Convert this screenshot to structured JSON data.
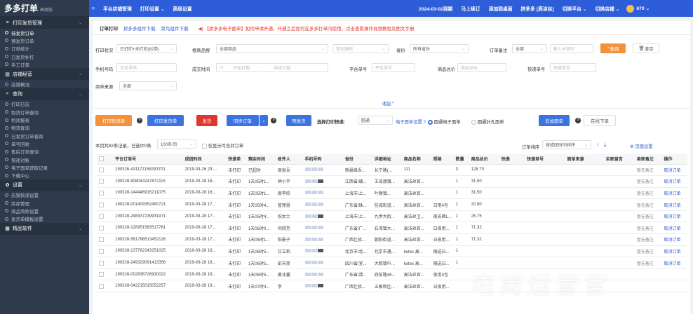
{
  "app": {
    "logo": "多多打单",
    "edition": "高级版"
  },
  "sidebar": {
    "sections": [
      {
        "label": "打印发货管理",
        "icon": "menu-icon",
        "items": [
          "待发货订单",
          "预发货订单",
          "订单统计",
          "已发货补打",
          "手工订单"
        ]
      },
      {
        "label": "店铺经营",
        "icon": "chart-icon",
        "items": [
          "店铺概况"
        ]
      },
      {
        "label": "查询",
        "icon": "search-icon",
        "items": [
          "打印日志",
          "取消订单查询",
          "利润报表",
          "物流查询",
          "已发货订单查询",
          "单号回收",
          "售后订单查询",
          "快递对账",
          "电子面单获取记录",
          "下载中心"
        ]
      },
      {
        "label": "设置",
        "icon": "gear-icon",
        "items": [
          "店铺快递设置",
          "库存管理",
          "商品简称设置",
          "发货单模板设置"
        ]
      },
      {
        "label": "精品软件",
        "icon": "grid-icon",
        "items": []
      }
    ]
  },
  "topbar": {
    "menu": [
      "平台店铺管理",
      "打印设置",
      "高级设置"
    ],
    "date": "2024-03-02到期",
    "renew": "马上续订",
    "add_desktop": "添加到桌面",
    "shop": "拼多多 [高洁丝]",
    "switch_platform": "切换平台",
    "switch_shop": "切换店铺",
    "count": "670"
  },
  "tabs": {
    "items": [
      "订单打印",
      "拼多多组件下载",
      "菜鸟组件下载"
    ],
    "notice": "【拼多多电子面单】如何申请开通，开通之后如何在多多打单内使用，点击查看操作视频教程及图文手册"
  },
  "filters": {
    "print_status": {
      "label": "打印状况",
      "value": "已打印+未打印(82单)"
    },
    "goods": {
      "label": "搜商品搜",
      "value": "全部商品"
    },
    "flag": {
      "placeholder": "暂无旗帜"
    },
    "province": {
      "label": "省份",
      "value": "所有省份"
    },
    "remark": {
      "label": "订单备注",
      "value": "全部",
      "placeholder": "输入关键字"
    },
    "query_btn": "查询",
    "clear_btn": "清空",
    "phone": {
      "label": "手机号码",
      "placeholder": "手机号码"
    },
    "deal_time": {
      "label": "成交时间",
      "start": "开始日期",
      "sep": "-",
      "end": "结束日期"
    },
    "platform_no": {
      "label": "平台单号",
      "placeholder": "平台单号"
    },
    "total": {
      "label": "商品总价",
      "placeholder": "商品总价"
    },
    "express_no": {
      "label": "快递单号",
      "placeholder": "快递单号"
    },
    "source": {
      "label": "商单来源",
      "value": "全部"
    },
    "collapse": "收起"
  },
  "actions": {
    "print_express": "打印快递单",
    "print_ship": "打印发货单",
    "ship": "发货",
    "sync": "同步订单",
    "pre_ship": "预发货",
    "choose_express": "选择打印快递:",
    "express_value": "圆通",
    "express_set": "电子面单设置",
    "radio1": "圆通电子面单",
    "radio2": "圆通针孔面单",
    "append": "追加面单",
    "online": "在线下单"
  },
  "summary": {
    "text": "本页共82条记录，已选中0条",
    "per_page": "100条/页",
    "merge": "仅显示可合并订单",
    "sort_label": "订单排序",
    "sort_value": "按成团时间排序",
    "page_settings": "页面设置"
  },
  "columns": [
    "平台订单号",
    "成团时间",
    "快递单",
    "剩余时间",
    "收件人",
    "手机号码",
    "省份",
    "详细地址",
    "商品名称",
    "规格",
    "数量",
    "商品总价",
    "快递",
    "快递单号",
    "面单来源",
    "买家留言",
    "卖家备注",
    "操作"
  ],
  "rows": [
    {
      "order": "190326-431172158293701",
      "time": "2019-03-26 23:...",
      "express": "未打印",
      "remain": "已超时",
      "name": "周俊吾",
      "province": "新疆维吾...",
      "addr": "长宁路(...",
      "goods": "111",
      "spec": "",
      "qty": "3",
      "price": "128.70",
      "remark": "暂无备注",
      "op": "取消订单"
    },
    {
      "order": "190328-508044247872115",
      "time": "2019-03-28 16...",
      "express": "未打印",
      "remain": "1天05时1...",
      "name": "钟小平",
      "province": "江西省/赣...",
      "addr": "王母渡镇...",
      "goods": "高洁丝官...",
      "spec": "",
      "qty": "1",
      "price": "31.50",
      "remark": "暂无备注",
      "op": "取消订单"
    },
    {
      "order": "190328-144446915211075",
      "time": "2019-03-28 16...",
      "express": "未打印",
      "remain": "1天05时1...",
      "name": "周李欣",
      "province": "上海市/上...",
      "addr": "叶榭镇...",
      "goods": "高洁丝官...",
      "spec": "",
      "qty": "1",
      "price": "31.50",
      "remark": "暂无备注",
      "op": "取消订单"
    },
    {
      "order": "190328-001409352490721",
      "time": "2019-03-28 17...",
      "express": "未打印",
      "remain": "1天05时4...",
      "name": "管理慧",
      "province": "广东省/珠...",
      "addr": "桂城街道...",
      "goods": "高洁丝官...",
      "spec": "日用4包",
      "qty": "1",
      "price": "20.80",
      "remark": "暂无备注",
      "op": "取消订单"
    },
    {
      "order": "190328-298337239931971",
      "time": "2019-03-28 17...",
      "express": "未打印",
      "remain": "1天05时4...",
      "name": "祝女士",
      "province": "上海市/上...",
      "addr": "九亭大街...",
      "goods": "高洁丝卫...",
      "spec": "夜安裤L...",
      "qty": "1",
      "price": "25.75",
      "remark": "暂无备注",
      "op": "取消订单"
    },
    {
      "order": "190328-128951583517761",
      "time": "2019-03-28 17...",
      "express": "未打印",
      "remain": "1天06时0...",
      "name": "何晓芳",
      "province": "广东省/广...",
      "addr": "石湾镇大...",
      "goods": "高洁丝官...",
      "spec": "日夜用...",
      "qty": "1",
      "price": "71.32",
      "remark": "暂无备注",
      "op": "取消订单"
    },
    {
      "order": "190328-561798513452126",
      "time": "2019-03-28 17...",
      "express": "未打印",
      "remain": "1天06时1...",
      "name": "阳豪子",
      "province": "广西壮族...",
      "addr": "朝阳街道...",
      "goods": "高洁丝官...",
      "spec": "日夜用...",
      "qty": "1",
      "price": "71.32",
      "remark": "暂无备注",
      "op": "取消订单"
    },
    {
      "order": "190328-137762243251025",
      "time": "2019-03-28 18...",
      "express": "未打印",
      "remain": "1天06时5...",
      "name": "甘立莉",
      "province": "北京市/北...",
      "addr": "北京市通...",
      "goods": "kotex 高...",
      "spec": "随选日...",
      "qty": "1",
      "price": "",
      "remark": "暂无备注",
      "op": "取消订单"
    },
    {
      "order": "190328-249329091413356",
      "time": "2019-03-28 18...",
      "express": "未打印",
      "remain": "1天06时5...",
      "name": "彭天奕",
      "province": "四川省/宜...",
      "addr": "大观镇中...",
      "goods": "kotex 高...",
      "spec": "随选日...",
      "qty": "1",
      "price": "",
      "remark": "暂无备注",
      "op": "取消订单"
    },
    {
      "order": "190328-002836726930022",
      "time": "2019-03-28 18...",
      "express": "未打印",
      "remain": "1天06时5...",
      "name": "黄冰蔓",
      "province": "广东省/清...",
      "addr": "府前路46...",
      "goods": "高洁丝官...",
      "spec": "夜用4包",
      "qty": "",
      "price": "",
      "remark": "",
      "op": ""
    },
    {
      "order": "190328-042215015052257",
      "time": "2019-03-28 19...",
      "express": "未打印",
      "remain": "1天07时4...",
      "name": "李",
      "province": "广西壮族...",
      "addr": "五象新区...",
      "goods": "高洁丝官...",
      "spec": "日夜用...",
      "qty": "",
      "price": "",
      "remark": "",
      "op": ""
    }
  ],
  "watermark": "电商运营官",
  "colors": {
    "topbar": "#2d5dd8",
    "sidebar": "#2f3b4c",
    "orange": "#f4913b",
    "red": "#e0362b",
    "blue": "#3b73e0"
  }
}
